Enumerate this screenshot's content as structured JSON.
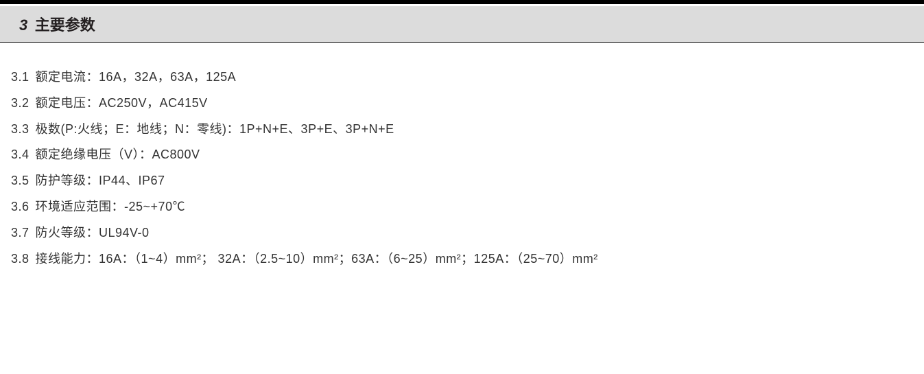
{
  "section": {
    "number": "3",
    "title": "主要参数"
  },
  "specs": [
    {
      "num": "3.1",
      "text": "额定电流：16A，32A，63A，125A"
    },
    {
      "num": "3.2",
      "text": "额定电压：AC250V，AC415V"
    },
    {
      "num": "3.3",
      "text": "极数(P:火线；E：地线；N：零线)：1P+N+E、3P+E、3P+N+E"
    },
    {
      "num": "3.4",
      "text": "额定绝缘电压（V）：AC800V"
    },
    {
      "num": "3.5",
      "text": "防护等级：IP44、IP67"
    },
    {
      "num": "3.6",
      "text": "环境适应范围：-25~+70℃"
    },
    {
      "num": "3.7",
      "text": "防火等级：UL94V-0"
    },
    {
      "num": "3.8",
      "text": "接线能力：16A：（1~4）mm²； 32A：（2.5~10）mm²；63A：（6~25）mm²；125A：（25~70）mm²"
    }
  ]
}
